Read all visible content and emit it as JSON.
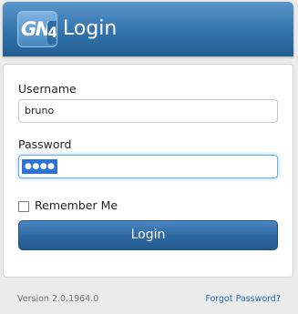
{
  "header": {
    "logo_text": "GN",
    "logo_number": "4",
    "title": "Login"
  },
  "form": {
    "username_label": "Username",
    "username_value": "bruno",
    "password_label": "Password",
    "password_mask": "●●●●",
    "remember_label": "Remember Me",
    "remember_checked": false,
    "login_button": "Login"
  },
  "footer": {
    "version": "Version 2.0.1964.0",
    "forgot_link": "Forgot Password?"
  },
  "colors": {
    "header_blue": "#3273ac",
    "button_blue": "#2f6aa5",
    "link_blue": "#2b6cb0",
    "focus_blue": "#66afe9"
  }
}
